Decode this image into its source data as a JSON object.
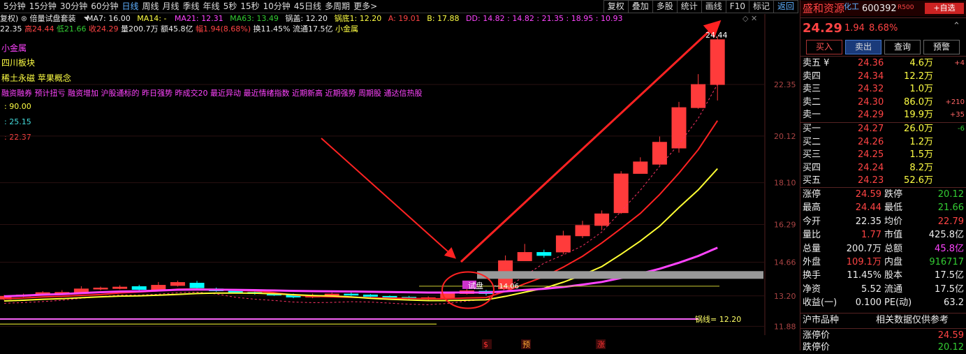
{
  "toolbar": {
    "timeframes": [
      "5分钟",
      "15分钟",
      "30分钟",
      "60分钟",
      "日线",
      "周线",
      "月线",
      "季线",
      "年线",
      "5秒",
      "15秒",
      "10分钟",
      "45日线",
      "多周期",
      "更多>"
    ],
    "active_index": 4,
    "tools": [
      "复权",
      "叠加",
      "多股",
      "统计",
      "画线",
      "F10",
      "标记",
      "返回"
    ]
  },
  "legend1": {
    "adj": "复权)",
    "indicator": "倍量试盘套装",
    "ma7": "MA7: 16.00",
    "ma14": "MA14: -",
    "ma21": "MA21: 12.31",
    "ma63": "MA63: 13.49",
    "guogai": "锅盖: 12.20",
    "guodi": "锅底1: 12.20",
    "a": "A: 19.01",
    "b": "B: 17.88",
    "dd": "DD: 14.82 : 14.82 : 21.35 : 18.95 : 10.93"
  },
  "legend2": {
    "open": "22.35",
    "high": "高24.44",
    "low": "低21.66",
    "close": "收24.29",
    "vol": "量200.7万",
    "amount": "额45.8亿",
    "change": "幅1.94(8.68%)",
    "turnover": "换11.45%",
    "float": "流通17.5亿",
    "sector": "小金属"
  },
  "tags": {
    "t1": "小金属",
    "t2": "四川板块",
    "t3": "稀土永磁 苹果概念",
    "t4": "融资融券 预计扭亏 融资增加 沪股通标的 昨日强势 昨成交20 最近异动 最近情绪指数 近期新高 近期强势 周期股 通达信热股",
    "v1": ": 90.00",
    "v2": ": 25.15",
    "v3": ": 22.37"
  },
  "axis": {
    "labels": [
      "22.35",
      "20.12",
      "18.10",
      "16.29",
      "14.66",
      "13.20",
      "11.88"
    ],
    "top_value": "24.44",
    "guo_line_label": "锅线= 12.20",
    "try_label": "试盘",
    "try_value": "~14.06",
    "markers": [
      "$",
      "预",
      "涨"
    ]
  },
  "chart_data": {
    "type": "candlestick",
    "candles": [
      [
        13.06,
        13.18,
        13.24,
        13.0
      ],
      [
        13.19,
        13.24,
        13.3,
        13.15
      ],
      [
        13.26,
        13.34,
        13.4,
        13.22
      ],
      [
        13.32,
        13.35,
        13.45,
        13.28
      ],
      [
        13.35,
        13.5,
        13.62,
        13.3
      ],
      [
        13.5,
        13.54,
        13.6,
        13.44
      ],
      [
        13.52,
        13.58,
        13.66,
        13.48
      ],
      [
        13.6,
        13.48,
        13.68,
        13.4
      ],
      [
        13.45,
        13.66,
        13.8,
        13.4
      ],
      [
        13.65,
        13.78,
        13.86,
        13.6
      ],
      [
        13.75,
        13.55,
        13.85,
        13.5
      ],
      [
        13.5,
        13.42,
        13.56,
        13.38
      ],
      [
        13.4,
        13.35,
        13.46,
        13.3
      ],
      [
        13.35,
        13.3,
        13.4,
        13.25
      ],
      [
        13.28,
        13.25,
        13.34,
        13.2
      ],
      [
        13.25,
        13.15,
        13.3,
        13.1
      ],
      [
        13.15,
        13.22,
        13.3,
        13.1
      ],
      [
        13.2,
        13.28,
        13.34,
        13.14
      ],
      [
        13.28,
        13.24,
        13.34,
        13.2
      ],
      [
        13.24,
        13.18,
        13.28,
        13.12
      ],
      [
        13.18,
        13.14,
        13.22,
        13.08
      ],
      [
        13.14,
        13.1,
        13.2,
        13.04
      ],
      [
        13.08,
        13.12,
        13.18,
        13.02
      ],
      [
        13.1,
        13.3,
        13.36,
        13.06
      ],
      [
        13.3,
        13.42,
        13.5,
        13.26
      ],
      [
        13.4,
        13.3,
        13.46,
        13.22
      ],
      [
        13.5,
        14.72,
        14.95,
        14.2
      ],
      [
        14.72,
        15.08,
        15.45,
        14.86
      ],
      [
        15.08,
        14.95,
        15.2,
        14.85
      ],
      [
        15.1,
        15.8,
        16.02,
        15.0
      ],
      [
        15.8,
        16.25,
        16.45,
        15.7
      ],
      [
        16.25,
        16.75,
        16.9,
        16.05
      ],
      [
        16.8,
        18.48,
        18.6,
        16.75
      ],
      [
        18.5,
        19.0,
        19.2,
        18.5
      ],
      [
        18.9,
        19.85,
        20.1,
        18.85
      ],
      [
        19.6,
        21.35,
        21.6,
        19.4
      ],
      [
        21.35,
        22.35,
        22.8,
        21.3
      ],
      [
        22.35,
        24.29,
        24.44,
        21.66
      ]
    ],
    "ylim": [
      11.5,
      24.8
    ],
    "ma_labels": [
      "MA7",
      "MA14",
      "MA21",
      "MA63"
    ]
  },
  "panel": {
    "name": "盛和资源",
    "suffix": "化工",
    "code": "600392",
    "r": "R500",
    "add_btn": "+自选",
    "price": "24.29",
    "chg": "1.94",
    "pct": "8.68%",
    "buttons": [
      "买入",
      "卖出",
      "查询",
      "预警"
    ],
    "sells": [
      {
        "label": "卖五 ¥",
        "price": "24.36",
        "vol": "4.6万",
        "delta": "+4"
      },
      {
        "label": "卖四",
        "price": "24.34",
        "vol": "12.2万",
        "delta": ""
      },
      {
        "label": "卖三",
        "price": "24.32",
        "vol": "1.0万",
        "delta": ""
      },
      {
        "label": "卖二",
        "price": "24.30",
        "vol": "86.0万",
        "delta": "+210"
      },
      {
        "label": "卖一",
        "price": "24.29",
        "vol": "19.9万",
        "delta": "+35"
      }
    ],
    "buys": [
      {
        "label": "买一",
        "price": "24.27",
        "vol": "26.0万",
        "delta": "-6"
      },
      {
        "label": "买二",
        "price": "24.26",
        "vol": "1.2万",
        "delta": ""
      },
      {
        "label": "买三",
        "price": "24.25",
        "vol": "1.5万",
        "delta": ""
      },
      {
        "label": "买四",
        "price": "24.24",
        "vol": "8.2万",
        "delta": ""
      },
      {
        "label": "买五",
        "price": "24.23",
        "vol": "52.6万",
        "delta": ""
      }
    ],
    "stats": [
      {
        "l1": "涨停",
        "v1": "24.59",
        "c1": "red",
        "l2": "跌停",
        "v2": "20.12",
        "c2": "green"
      },
      {
        "l1": "最高",
        "v1": "24.44",
        "c1": "red",
        "l2": "最低",
        "v2": "21.66",
        "c2": "green"
      },
      {
        "l1": "今开",
        "v1": "22.35",
        "c1": "white",
        "l2": "均价",
        "v2": "22.79",
        "c2": "red"
      },
      {
        "l1": "量比",
        "v1": "1.77",
        "c1": "red",
        "l2": "市值",
        "v2": "425.8亿",
        "c2": "white"
      },
      {
        "l1": "总量",
        "v1": "200.7万",
        "c1": "white",
        "l2": "总额",
        "v2": "45.8亿",
        "c2": "mag"
      },
      {
        "l1": "外盘",
        "v1": "109.1万",
        "c1": "red",
        "l2": "内盘",
        "v2": "916717",
        "c2": "green"
      },
      {
        "l1": "换手",
        "v1": "11.45%",
        "c1": "white",
        "l2": "股本",
        "v2": "17.5亿",
        "c2": "white"
      },
      {
        "l1": "净资",
        "v1": "5.52",
        "c1": "white",
        "l2": "流通",
        "v2": "17.5亿",
        "c2": "white"
      },
      {
        "l1": "收益(一)",
        "v1": "0.100",
        "c1": "white",
        "l2": "PE(动)",
        "v2": "63.2",
        "c2": "white"
      }
    ],
    "market": "沪市品种",
    "market_note": "相关数据仅供参考",
    "zt_label": "涨停价",
    "zt_value": "24.59",
    "dt_label": "跌停价",
    "dt_value": "20.12"
  }
}
